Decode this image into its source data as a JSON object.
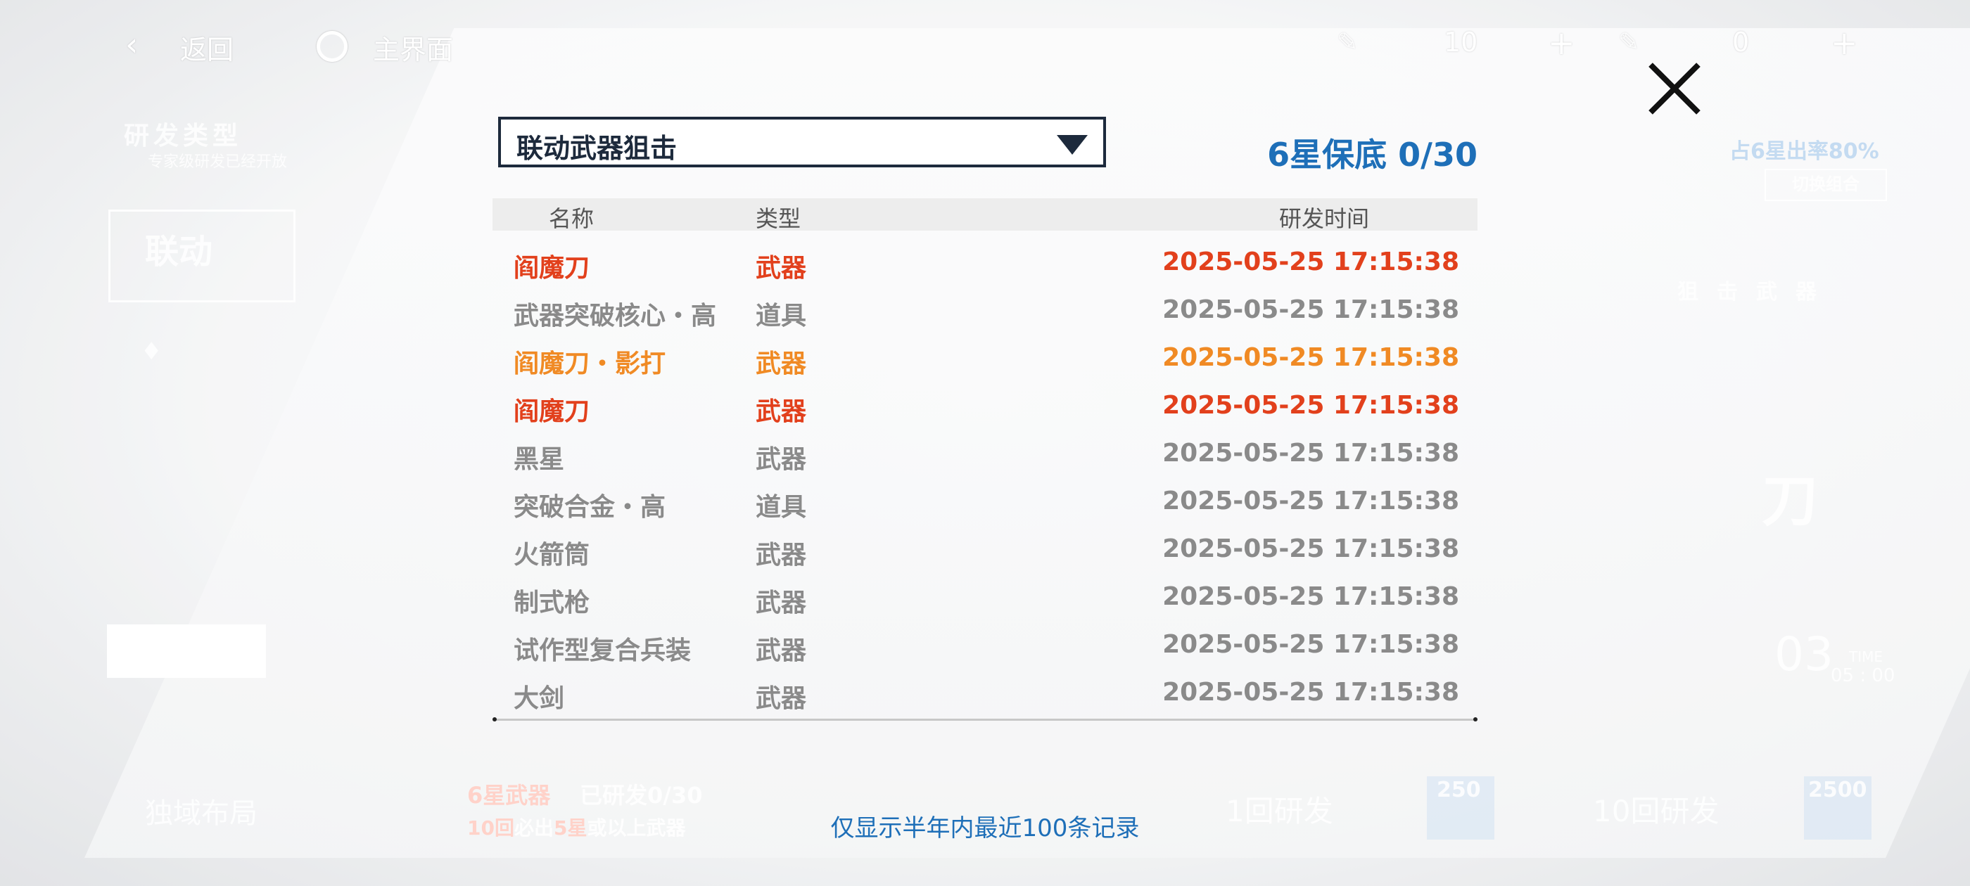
{
  "topbar": {
    "back_label": "返回",
    "home_label": "主界面",
    "currency1_value": "10",
    "currency2_value": "0",
    "plus": "+"
  },
  "background": {
    "research_type_title": "研发类型",
    "research_type_sub": "专家级研发已经开放",
    "banner_label": "联动",
    "rate_text": "占6星出率80%",
    "switch_combo": "切换组合",
    "weapon_tags": [
      "狙",
      "击",
      "武",
      "器"
    ],
    "time_label": "TIME",
    "time_value": "05 : 00",
    "timer_digits": "03",
    "bottom_left": "独域布局",
    "six_star_research": "6星武器",
    "researched": "已研发0/30",
    "guarantee_line_a": "10回",
    "guarantee_line_b": "必出",
    "guarantee_line_c": "5星",
    "guarantee_line_d": "或以上武器",
    "once_label": "1回研发",
    "once_cost": "250",
    "ten_label": "10回研发",
    "ten_cost": "2500",
    "weapon_name_partial": "刀"
  },
  "modal": {
    "select_value": "联动武器狙击",
    "pity_text": "6星保底 0/30",
    "columns": {
      "name": "名称",
      "type": "类型",
      "time": "研发时间"
    },
    "rows": [
      {
        "name": "阎魔刀",
        "type": "武器",
        "time": "2025-05-25 17:15:38",
        "rarity": "red"
      },
      {
        "name": "武器突破核心・高",
        "type": "道具",
        "time": "2025-05-25 17:15:38",
        "rarity": "gray"
      },
      {
        "name": "阎魔刀・影打",
        "type": "武器",
        "time": "2025-05-25 17:15:38",
        "rarity": "orange"
      },
      {
        "name": "阎魔刀",
        "type": "武器",
        "time": "2025-05-25 17:15:38",
        "rarity": "red"
      },
      {
        "name": "黑星",
        "type": "武器",
        "time": "2025-05-25 17:15:38",
        "rarity": "gray"
      },
      {
        "name": "突破合金・高",
        "type": "道具",
        "time": "2025-05-25 17:15:38",
        "rarity": "gray"
      },
      {
        "name": "火箭筒",
        "type": "武器",
        "time": "2025-05-25 17:15:38",
        "rarity": "gray"
      },
      {
        "name": "制式枪",
        "type": "武器",
        "time": "2025-05-25 17:15:38",
        "rarity": "gray"
      },
      {
        "name": "试作型复合兵装",
        "type": "武器",
        "time": "2025-05-25 17:15:38",
        "rarity": "gray"
      },
      {
        "name": "大剑",
        "type": "武器",
        "time": "2025-05-25 17:15:38",
        "rarity": "gray"
      }
    ],
    "footnote": "仅显示半年内最近100条记录"
  }
}
